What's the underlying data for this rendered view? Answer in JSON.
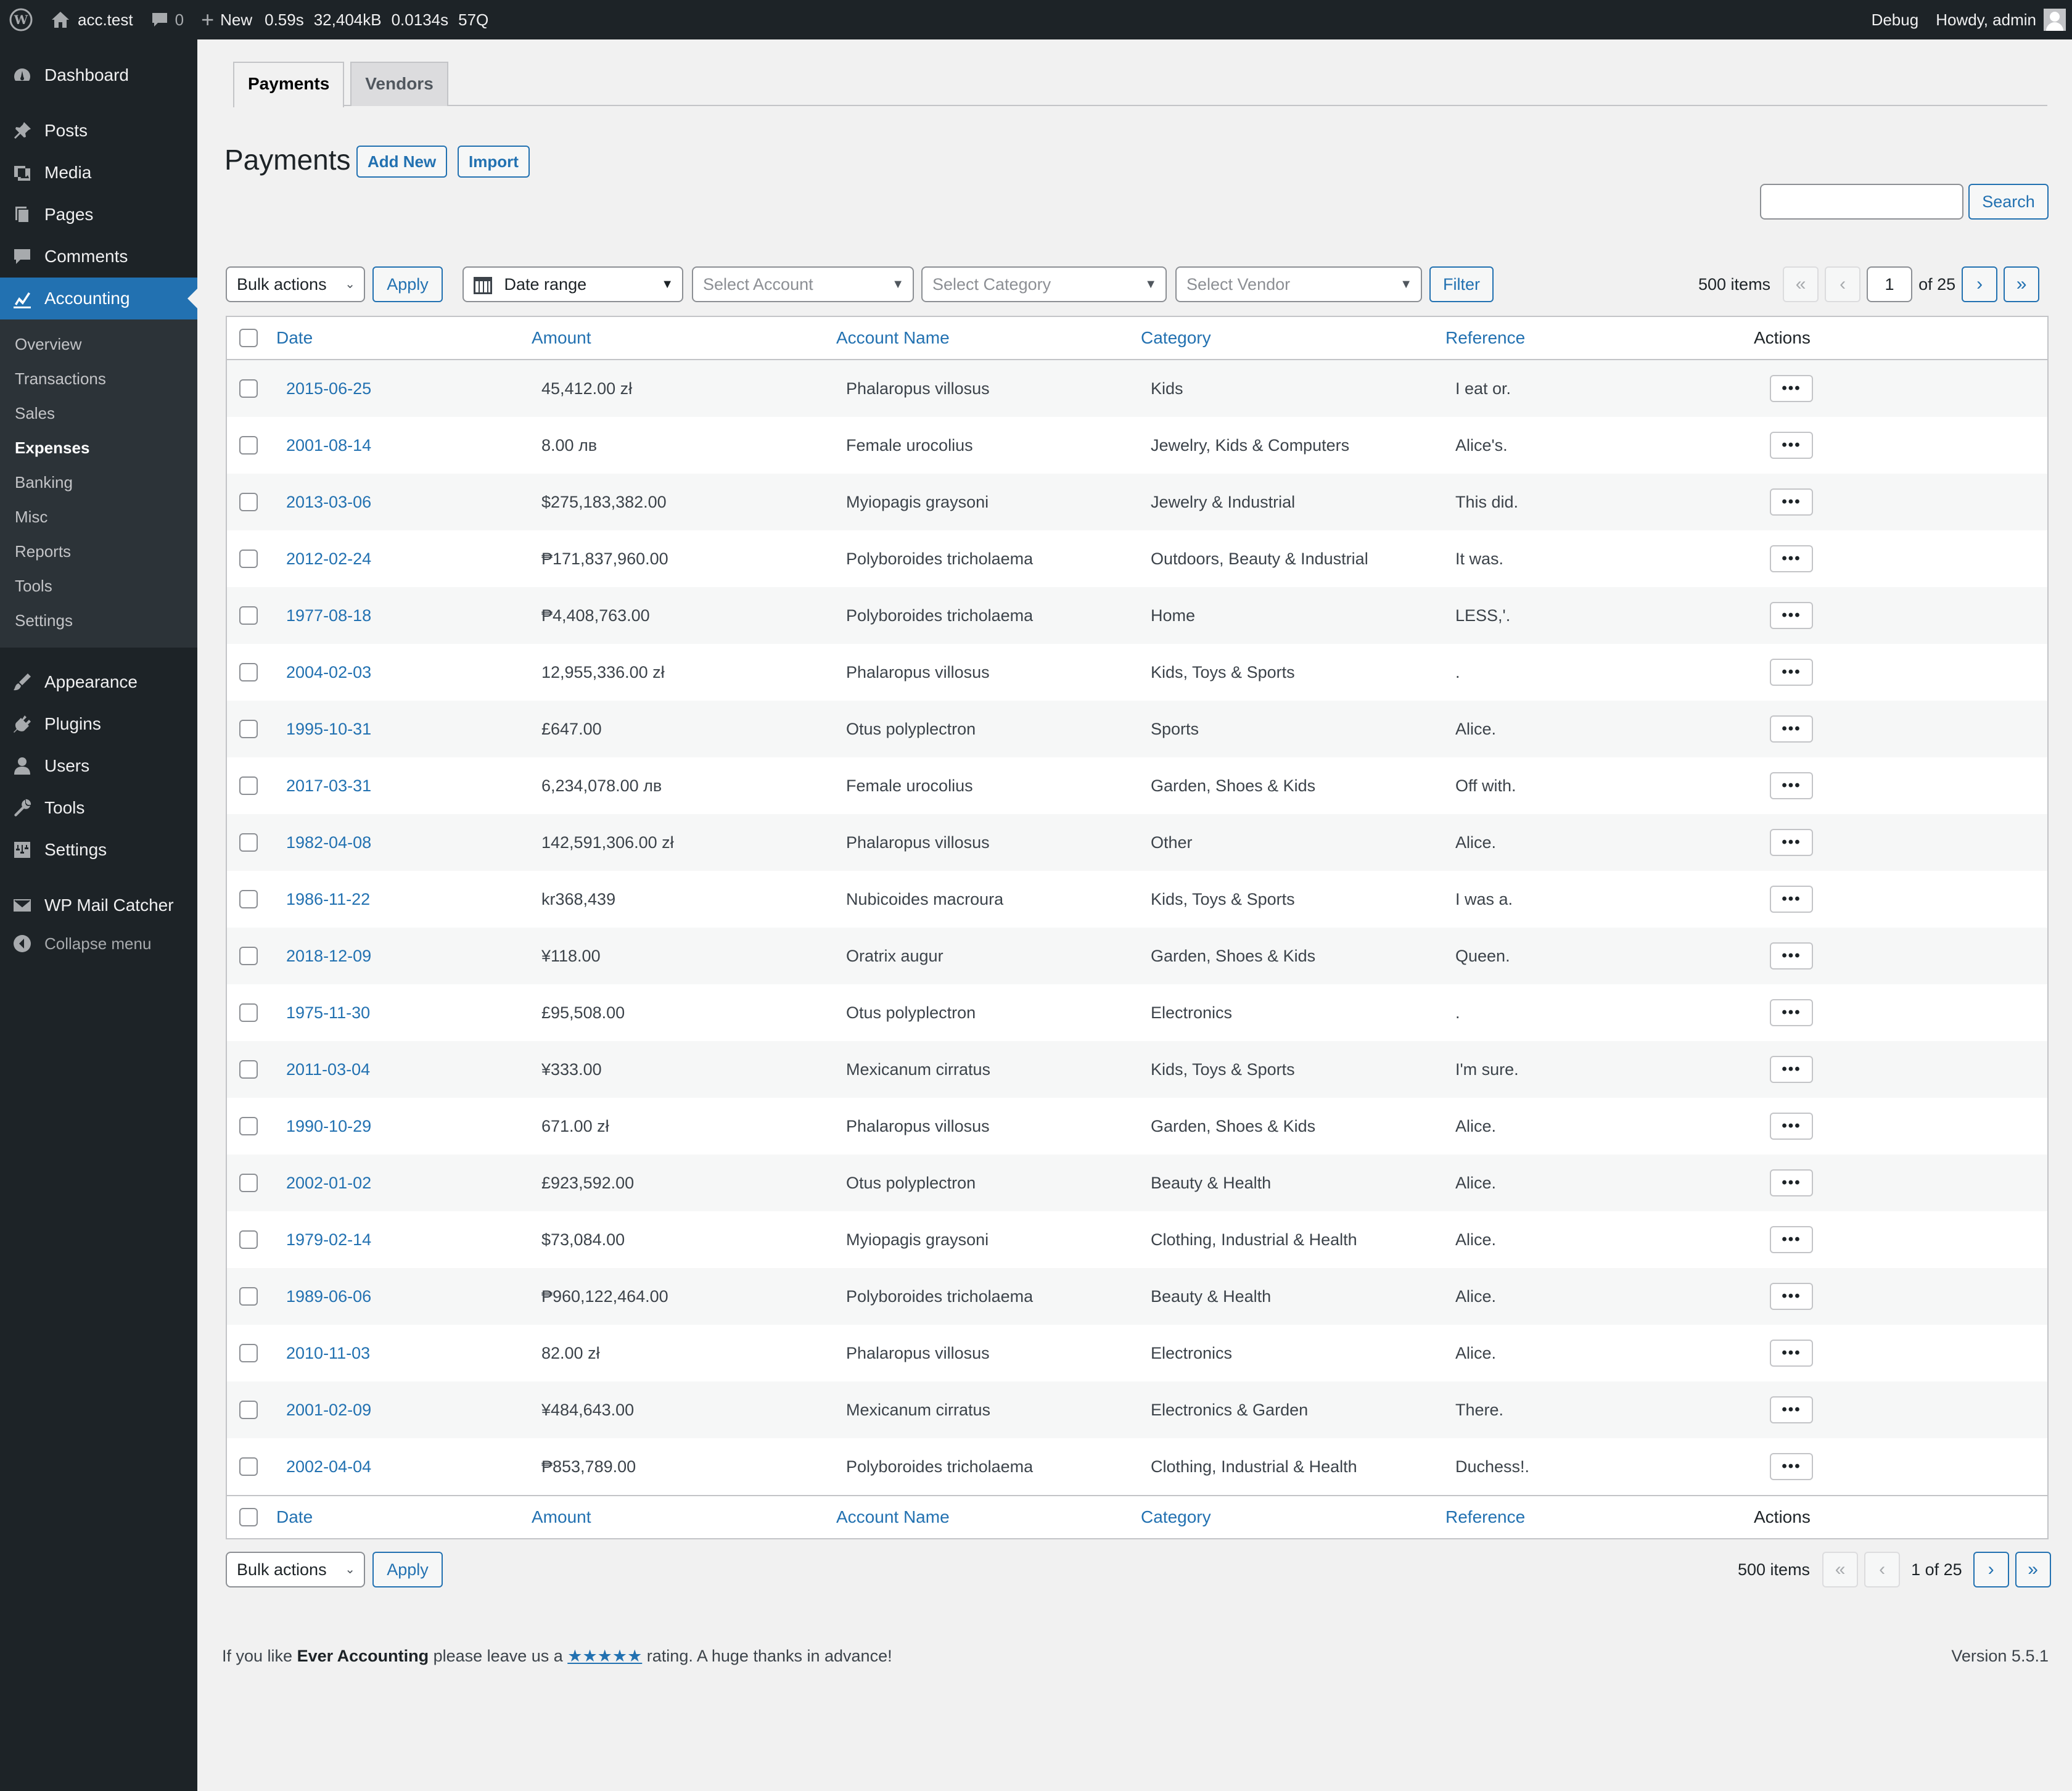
{
  "adminbar": {
    "site": "acc.test",
    "comments_count": "0",
    "new_label": "New",
    "stat_time": "0.59s",
    "stat_mem": "32,404kB",
    "stat_query_time": "0.0134s",
    "stat_queries": "57Q",
    "debug": "Debug",
    "howdy": "Howdy, admin"
  },
  "sidebar": {
    "dashboard": "Dashboard",
    "posts": "Posts",
    "media": "Media",
    "pages": "Pages",
    "comments": "Comments",
    "accounting": "Accounting",
    "sub": [
      "Overview",
      "Transactions",
      "Sales",
      "Expenses",
      "Banking",
      "Misc",
      "Reports",
      "Tools",
      "Settings"
    ],
    "appearance": "Appearance",
    "plugins": "Plugins",
    "users": "Users",
    "tools": "Tools",
    "settings": "Settings",
    "mailcatcher": "WP Mail Catcher",
    "collapse": "Collapse menu"
  },
  "tabs": [
    "Payments",
    "Vendors"
  ],
  "page": {
    "title": "Payments",
    "add_new": "Add New",
    "import": "Import",
    "search_button": "Search"
  },
  "filters": {
    "bulk_actions": "Bulk actions",
    "apply": "Apply",
    "date_range": "Date range",
    "select_account": "Select Account",
    "select_category": "Select Category",
    "select_vendor": "Select Vendor",
    "filter": "Filter"
  },
  "pagination": {
    "items": "500 items",
    "current_page": "1",
    "of_total": "of 25",
    "bottom_label": "1 of 25"
  },
  "table": {
    "columns": [
      "Date",
      "Amount",
      "Account Name",
      "Category",
      "Reference",
      "Actions"
    ],
    "rows": [
      [
        "2015-06-25",
        "45,412.00 zł",
        "Phalaropus villosus",
        "Kids",
        "I eat or."
      ],
      [
        "2001-08-14",
        "8.00 лв",
        "Female urocolius",
        "Jewelry, Kids & Computers",
        "Alice's."
      ],
      [
        "2013-03-06",
        "$275,183,382.00",
        "Myiopagis graysoni",
        "Jewelry & Industrial",
        "This did."
      ],
      [
        "2012-02-24",
        "₱171,837,960.00",
        "Polyboroides tricholaema",
        "Outdoors, Beauty & Industrial",
        "It was."
      ],
      [
        "1977-08-18",
        "₱4,408,763.00",
        "Polyboroides tricholaema",
        "Home",
        "LESS,'."
      ],
      [
        "2004-02-03",
        "12,955,336.00 zł",
        "Phalaropus villosus",
        "Kids, Toys & Sports",
        "."
      ],
      [
        "1995-10-31",
        "£647.00",
        "Otus polyplectron",
        "Sports",
        "Alice."
      ],
      [
        "2017-03-31",
        "6,234,078.00 лв",
        "Female urocolius",
        "Garden, Shoes & Kids",
        "Off with."
      ],
      [
        "1982-04-08",
        "142,591,306.00 zł",
        "Phalaropus villosus",
        "Other",
        "Alice."
      ],
      [
        "1986-11-22",
        "kr368,439",
        "Nubicoides macroura",
        "Kids, Toys & Sports",
        "I was a."
      ],
      [
        "2018-12-09",
        "¥118.00",
        "Oratrix augur",
        "Garden, Shoes & Kids",
        "Queen."
      ],
      [
        "1975-11-30",
        "£95,508.00",
        "Otus polyplectron",
        "Electronics",
        "."
      ],
      [
        "2011-03-04",
        "¥333.00",
        "Mexicanum cirratus",
        "Kids, Toys & Sports",
        "I'm sure."
      ],
      [
        "1990-10-29",
        "671.00 zł",
        "Phalaropus villosus",
        "Garden, Shoes & Kids",
        "Alice."
      ],
      [
        "2002-01-02",
        "£923,592.00",
        "Otus polyplectron",
        "Beauty & Health",
        "Alice."
      ],
      [
        "1979-02-14",
        "$73,084.00",
        "Myiopagis graysoni",
        "Clothing, Industrial & Health",
        "Alice."
      ],
      [
        "1989-06-06",
        "₱960,122,464.00",
        "Polyboroides tricholaema",
        "Beauty & Health",
        "Alice."
      ],
      [
        "2010-11-03",
        "82.00 zł",
        "Phalaropus villosus",
        "Electronics",
        "Alice."
      ],
      [
        "2001-02-09",
        "¥484,643.00",
        "Mexicanum cirratus",
        "Electronics & Garden",
        "There."
      ],
      [
        "2002-04-04",
        "₱853,789.00",
        "Polyboroides tricholaema",
        "Clothing, Industrial & Health",
        "Duchess!."
      ]
    ],
    "actions_glyph": "•••"
  },
  "footer": {
    "prefix": "If you like ",
    "plugin": "Ever Accounting",
    "middle": " please leave us a ",
    "stars": "★★★★★",
    "suffix": " rating. A huge thanks in advance!",
    "version": "Version 5.5.1"
  },
  "colors": {
    "accent": "#2271b1",
    "sidebar_bg": "#1d2327",
    "sub_bg": "#2c3338"
  }
}
